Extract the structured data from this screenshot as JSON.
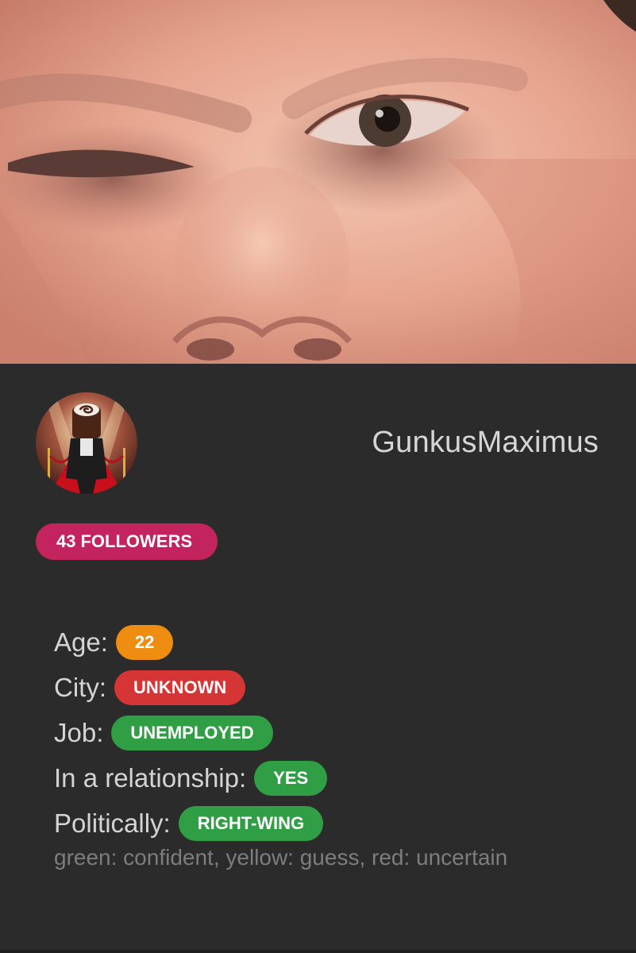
{
  "profile": {
    "username": "GunkusMaximus",
    "followers_count": "43",
    "followers_label": "FOLLOWERS"
  },
  "details": [
    {
      "label": "Age:",
      "value": "22",
      "status": "guess",
      "color": "#ef8c12"
    },
    {
      "label": "City:",
      "value": "UNKNOWN",
      "status": "uncertain",
      "color": "#d63535"
    },
    {
      "label": "Job:",
      "value": "UNEMPLOYED",
      "status": "confident",
      "color": "#2f9e44"
    },
    {
      "label": "In a relationship:",
      "value": "YES",
      "status": "confident",
      "color": "#2f9e44"
    },
    {
      "label": "Politically:",
      "value": "RIGHT-WING",
      "status": "confident",
      "color": "#2f9e44"
    }
  ],
  "legend": "green: confident, yellow: guess, red: uncertain",
  "colors": {
    "card_background": "#2b2b2b",
    "followers_badge": "#c4245e",
    "confident": "#2f9e44",
    "guess": "#ef8c12",
    "uncertain": "#d63535"
  },
  "images": {
    "banner": "close-up face photo",
    "avatar": "figure in suit with cake-roll head on red carpet"
  }
}
